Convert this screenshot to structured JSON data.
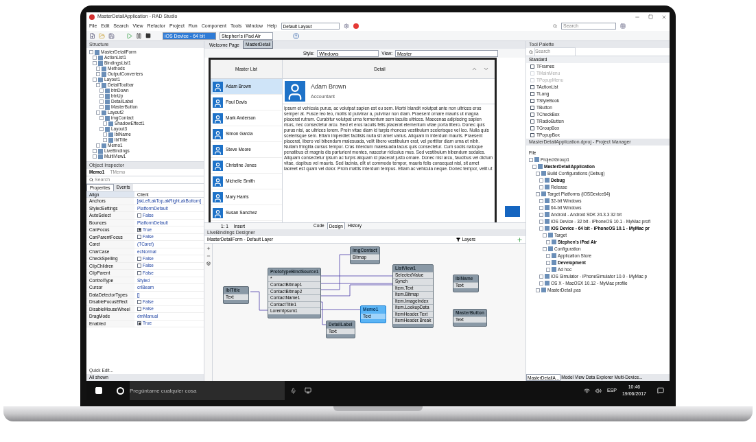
{
  "window": {
    "title": "MasterDetailApplication - RAD Studio"
  },
  "menu": [
    "File",
    "Edit",
    "Search",
    "View",
    "Refactor",
    "Project",
    "Run",
    "Component",
    "Tools",
    "Window",
    "Help"
  ],
  "layout_combo": "Default Layout",
  "search_placeholder": "Search",
  "toolbar": {
    "platform_combo": "iOS Device - 64 bit",
    "device_combo": "Stephen's iPad Air"
  },
  "structure": {
    "title": "Structure",
    "tree": [
      {
        "label": "MasterDetailForm",
        "children": [
          {
            "label": "ActionList1"
          },
          {
            "label": "BindingsList1",
            "children": [
              {
                "label": "Methods"
              },
              {
                "label": "OutputConverters"
              }
            ]
          },
          {
            "label": "Layout1",
            "children": [
              {
                "label": "DetailToolbar",
                "children": [
                  {
                    "label": "btnDown"
                  },
                  {
                    "label": "btnUp"
                  },
                  {
                    "label": "DetailLabel"
                  },
                  {
                    "label": "MasterButton"
                  }
                ]
              },
              {
                "label": "Layout2",
                "children": [
                  {
                    "label": "imgContact",
                    "children": [
                      {
                        "label": "ShadowEffect1"
                      }
                    ]
                  },
                  {
                    "label": "Layout3",
                    "children": [
                      {
                        "label": "lblName"
                      },
                      {
                        "label": "lblTitle"
                      }
                    ]
                  }
                ]
              },
              {
                "label": "Memo1"
              }
            ]
          },
          {
            "label": "LiveBindings"
          },
          {
            "label": "MultiView1"
          }
        ]
      }
    ]
  },
  "inspector": {
    "title": "Object Inspector",
    "object": "Memo1",
    "object_type": "TMemo",
    "search_placeholder": "Search",
    "tabs": [
      {
        "label": "Properties",
        "selected": true
      },
      {
        "label": "Events",
        "selected": false
      }
    ],
    "header": {
      "name": "Align",
      "value": "Client"
    },
    "rows": [
      {
        "kind": "text",
        "name": "Anchors",
        "value": "[akLeft,akTop,akRight,akBottom]"
      },
      {
        "kind": "text",
        "name": "StyledSettings",
        "value": "PlatformDefault"
      },
      {
        "kind": "check",
        "name": "AutoSelect",
        "value": "False",
        "checked": false
      },
      {
        "kind": "text",
        "name": "Bounces",
        "value": "PlatformDefault"
      },
      {
        "kind": "check",
        "name": "CanFocus",
        "value": "True",
        "checked": true
      },
      {
        "kind": "check",
        "name": "CanParentFocus",
        "value": "False",
        "checked": false
      },
      {
        "kind": "text",
        "name": "Caret",
        "value": "(TCaret)"
      },
      {
        "kind": "text",
        "name": "CharCase",
        "value": "ecNormal"
      },
      {
        "kind": "check",
        "name": "CheckSpelling",
        "value": "False",
        "checked": false
      },
      {
        "kind": "check",
        "name": "ClipChildren",
        "value": "False",
        "checked": false
      },
      {
        "kind": "check",
        "name": "ClipParent",
        "value": "False",
        "checked": false
      },
      {
        "kind": "text",
        "name": "ControlType",
        "value": "Styled"
      },
      {
        "kind": "text",
        "name": "Cursor",
        "value": "crIBeam"
      },
      {
        "kind": "text",
        "name": "DataDetectorTypes",
        "value": "[]"
      },
      {
        "kind": "check",
        "name": "DisableFocusEffect",
        "value": "False",
        "checked": false
      },
      {
        "kind": "check",
        "name": "DisableMouseWheel",
        "value": "False",
        "checked": false
      },
      {
        "kind": "text",
        "name": "DragMode",
        "value": "dmManual"
      },
      {
        "kind": "check",
        "name": "Enabled",
        "value": "True",
        "checked": true
      }
    ],
    "footer_link": "Quick Edit...",
    "status": "All shown"
  },
  "editor": {
    "tabs": [
      {
        "label": "Welcome Page",
        "selected": false
      },
      {
        "label": "MasterDetail",
        "selected": true
      }
    ],
    "style_label": "Style:",
    "style_value": "Windows",
    "view_label": "View:",
    "view_value": "Master"
  },
  "form": {
    "master_header": "Master List",
    "detail_header": "Detail",
    "contacts": [
      {
        "name": "Adam Brown",
        "selected": true
      },
      {
        "name": "Paul Davis",
        "selected": false
      },
      {
        "name": "Mark Anderson",
        "selected": false
      },
      {
        "name": "Simon Garcia",
        "selected": false
      },
      {
        "name": "Steve Moore",
        "selected": false
      },
      {
        "name": "Christine Jones",
        "selected": false
      },
      {
        "name": "Michelle Smith",
        "selected": false
      },
      {
        "name": "Mary Harris",
        "selected": false
      },
      {
        "name": "Susan Sanchez",
        "selected": false
      }
    ],
    "detail": {
      "name": "Adam Brown",
      "title": "Accountant",
      "body": "Ipsum et vehicula purus, ac volutpat sapien est eu sem. Morbi blandit volutpat ante non ultrices eros semper at. Fusce leo leo, mollis id pulvinar a, pulvinar non diam. Praesent ornare mauris ut magna placerat rutrum. Curabitur volutpat urna fermentum sem iaculis ultrices. Maecenas adipiscing sapien risus, nec consectetur arcu. Sed et eros iaculis felis placerat elementum vitae porta libero. Donec quis purus nisi, ac ultrices lorem. Proin vitae diam id turpis rhoncus vestibulum scelerisque vel leo. Nulla quis scelerisque sem. Etiam imperdiet facilisis nulla sit amet varius. Aliquam in interdum mauris. Praesent placerat, libero vel bibendum malesuada, velit libero vestibulum erat, vel porttitor diam urna et nibh. Nullam fringilla cursus tempor. Cras interdum malesuada lacus quis consectetur. Cum sociis natoque penatibus et magnis dis parturient montes, nascetur ridiculus mus. Sed vestibulum bibendum sodales. Aliquam consectetur ipsum ac turpis aliquam id placerat justo ornare. Donec nisl arcu, faucibus vel dictum vitae, dapibus vel mauris. Sed lacinia, elit ut commodo tempor, mauris felis consequat nisl, sit amet laoreet est quam vel dolor. Proin mattis interdum tempus. Etiam ac vehicula neque. Donec tempor, velit ut"
    }
  },
  "form_status": {
    "position": "1: 1",
    "mode": "Insert",
    "tabs": [
      {
        "label": "Code",
        "selected": false
      },
      {
        "label": "Design",
        "selected": true
      },
      {
        "label": "History",
        "selected": false
      }
    ]
  },
  "livebindings": {
    "title": "LiveBindings Designer",
    "layer": "MasterDetailForm - Default Layer",
    "layers_button": "Layers",
    "nodes": [
      {
        "title": "lblTitle",
        "fields": [
          "Text"
        ],
        "selected": false
      },
      {
        "title": "PrototypeBindSource1",
        "fields": [
          "*",
          "ContactBitmap1",
          "ContactBitmap2",
          "ContactName1",
          "ContactTitle1",
          "LoremIpsum1"
        ],
        "selected": false
      },
      {
        "title": "imgContact",
        "fields": [
          "Bitmap"
        ],
        "selected": false
      },
      {
        "title": "ListView1",
        "fields": [
          "SelectedValue",
          "Synch",
          "Item.Text",
          "Item.Bitmap",
          "Item.ImageIndex",
          "Item.LookupData",
          "ItemHeader.Text",
          "ItemHeader.Break"
        ],
        "selected": false
      },
      {
        "title": "lblName",
        "fields": [
          "Text"
        ],
        "selected": false
      },
      {
        "title": "Memo1",
        "fields": [
          "Text"
        ],
        "selected": true
      },
      {
        "title": "DetailLabel",
        "fields": [
          "Text"
        ],
        "selected": false
      },
      {
        "title": "MasterButton",
        "fields": [
          "Text"
        ],
        "selected": false
      }
    ]
  },
  "tool_palette": {
    "title": "Tool Palette",
    "search_placeholder": "Search",
    "category": "Standard",
    "items": [
      {
        "label": "TFrames",
        "disabled": false
      },
      {
        "label": "TMainMenu",
        "disabled": true
      },
      {
        "label": "TPopupMenu",
        "disabled": true
      },
      {
        "label": "TActionList",
        "disabled": false
      },
      {
        "label": "TLang",
        "disabled": false
      },
      {
        "label": "TStyleBook",
        "disabled": false
      },
      {
        "label": "TButton",
        "disabled": false
      },
      {
        "label": "TCheckBox",
        "disabled": false
      },
      {
        "label": "TRadioButton",
        "disabled": false
      },
      {
        "label": "TGroupBox",
        "disabled": false
      },
      {
        "label": "TPopupBox",
        "disabled": false
      }
    ]
  },
  "project": {
    "title": "MasterDetailApplication.dproj - Project Manager",
    "file_label": "File",
    "tree": [
      {
        "label": "ProjectGroup1",
        "active": false,
        "children": [
          {
            "label": "MasterDetailApplication",
            "active": true,
            "children": [
              {
                "label": "Build Configurations (Debug)",
                "active": false,
                "children": [
                  {
                    "label": "Debug",
                    "active": true
                  },
                  {
                    "label": "Release",
                    "active": false
                  }
                ]
              },
              {
                "label": "Target Platforms (iOSDevice64)",
                "active": false,
                "children": [
                  {
                    "label": "32-bit Windows",
                    "active": false
                  },
                  {
                    "label": "64-bit Windows",
                    "active": false
                  },
                  {
                    "label": "Android - Android SDK 24.3.3 32 bit",
                    "active": false
                  },
                  {
                    "label": "iOS Device - 32 bit - iPhoneOS 10.1 - MyMac profi",
                    "active": false
                  },
                  {
                    "label": "iOS Device - 64 bit - iPhoneOS 10.1 - MyMac pr",
                    "active": true,
                    "children": [
                      {
                        "label": "Target",
                        "active": false,
                        "children": [
                          {
                            "label": "Stephen's iPad Air",
                            "active": true
                          }
                        ]
                      },
                      {
                        "label": "Configuration",
                        "active": false,
                        "children": [
                          {
                            "label": "Application Store",
                            "active": false
                          },
                          {
                            "label": "Development",
                            "active": true
                          },
                          {
                            "label": "Ad hoc",
                            "active": false
                          }
                        ]
                      }
                    ]
                  },
                  {
                    "label": "iOS Simulator - iPhoneSimulator 10.0 - MyMac p",
                    "active": false
                  },
                  {
                    "label": "OS X - MacOSX 10.12 - MyMac profile",
                    "active": false
                  }
                ]
              },
              {
                "label": "MasterDetail.pas",
                "active": false
              }
            ]
          }
        ]
      }
    ]
  },
  "bottom_tabs": [
    {
      "label": "MasterDetailA...",
      "selected": true
    },
    {
      "label": "Model View",
      "selected": false
    },
    {
      "label": "Data Explorer",
      "selected": false
    },
    {
      "label": "Multi-Device...",
      "selected": false
    }
  ],
  "taskbar": {
    "search_placeholder": "Pregúntame cualquier cosa",
    "language": "ESP",
    "time": "10:46",
    "date": "19/06/2017"
  }
}
